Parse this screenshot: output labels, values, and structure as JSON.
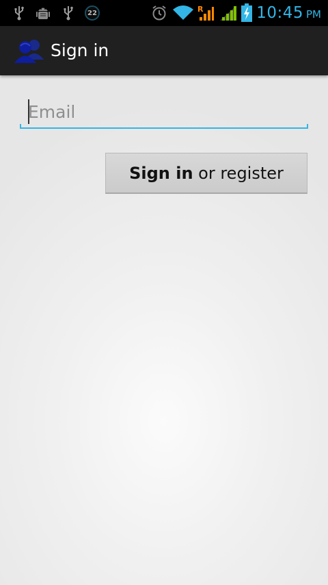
{
  "status_bar": {
    "icons_left": [
      "usb-icon",
      "android-debug-icon",
      "usb-icon",
      "notification-count-icon"
    ],
    "notification_count": "22",
    "icons_right": [
      "alarm-icon",
      "wifi-icon",
      "roaming-signal-icon",
      "signal-icon",
      "battery-charging-icon"
    ],
    "roaming_label": "R",
    "time": "10:45",
    "ampm": "PM",
    "accent_color": "#33b5e5"
  },
  "action_bar": {
    "app_icon": "people-icon",
    "title": "Sign in"
  },
  "form": {
    "email_placeholder": "Email",
    "email_value": "",
    "button_bold": "Sign in",
    "button_rest": " or register"
  }
}
